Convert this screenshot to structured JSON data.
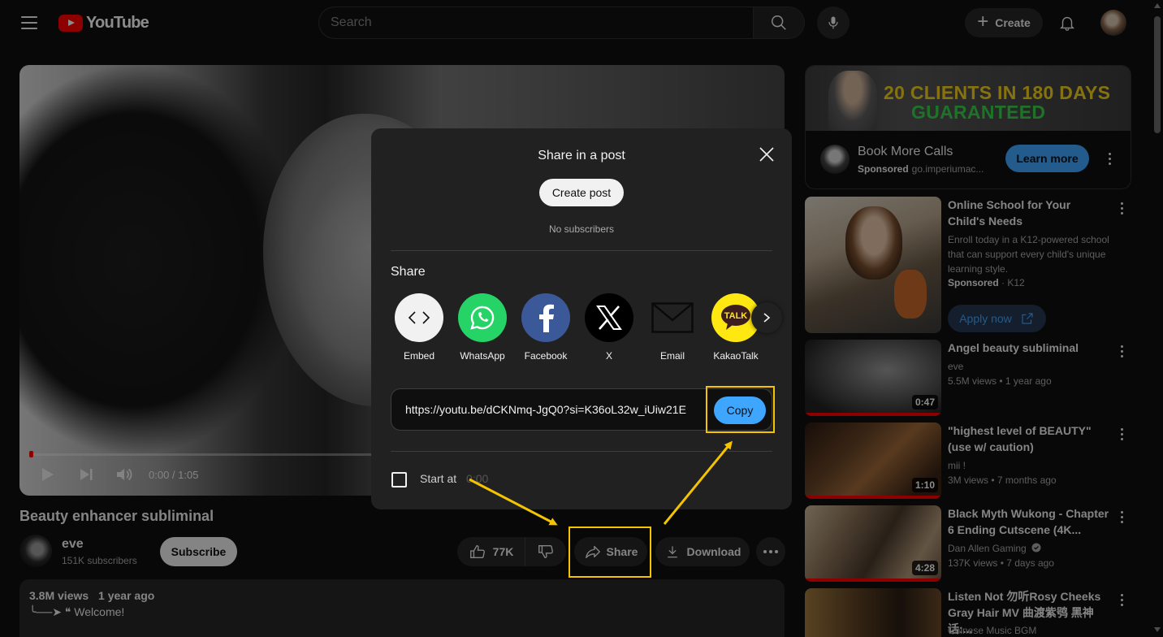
{
  "header": {
    "logo_text": "YouTube",
    "search_placeholder": "Search",
    "create_label": "Create"
  },
  "player": {
    "time": "0:00 / 1:05",
    "progress_fraction": 0.005
  },
  "video": {
    "title": "Beauty enhancer subliminal",
    "channel": "eve",
    "subscribers": "151K subscribers",
    "subscribe_label": "Subscribe",
    "likes": "77K",
    "share_label": "Share",
    "download_label": "Download",
    "views": "3.8M views",
    "age": "1 year ago",
    "description": "╰──➤ ❝ Welcome!"
  },
  "share_dialog": {
    "title": "Share in a post",
    "create_post_label": "Create post",
    "no_subscribers": "No subscribers",
    "share_heading": "Share",
    "targets": [
      {
        "label": "Embed",
        "icon": "embed-icon",
        "color": "#f1f1f1"
      },
      {
        "label": "WhatsApp",
        "icon": "whatsapp-icon",
        "color": "#25d366"
      },
      {
        "label": "Facebook",
        "icon": "facebook-icon",
        "color": "#3b5998"
      },
      {
        "label": "X",
        "icon": "x-icon",
        "color": "#000000"
      },
      {
        "label": "Email",
        "icon": "email-icon",
        "color": "#212121"
      },
      {
        "label": "KakaoTalk",
        "icon": "kakaotalk-icon",
        "color": "#ffe812"
      }
    ],
    "url": "https://youtu.be/dCKNmq-JgQ0?si=K36oL32w_iUiw21E",
    "copy_label": "Copy",
    "start_at_label": "Start at",
    "start_at_time": "0:00"
  },
  "sidebar": {
    "ad": {
      "headline_1": "20 CLIENTS IN 180 DAYS",
      "headline_2": "GUARANTEED",
      "title": "Book More Calls",
      "sponsored": "Sponsored",
      "domain": "go.imperiumac...",
      "cta": "Learn more"
    },
    "recommendations": [
      {
        "title": "Online School for Your Child's Needs",
        "description": "Enroll today in a K12-powered school that can support every child's unique learning style.",
        "sponsored": "Sponsored",
        "advertiser": "K12",
        "cta": "Apply now"
      },
      {
        "title": "Angel beauty subliminal",
        "channel": "eve",
        "views": "5.5M views",
        "age": "1 year ago",
        "duration": "0:47"
      },
      {
        "title": "\"highest level of BEAUTY\" (use w/ caution)",
        "channel": "mii !",
        "views": "3M views",
        "age": "7 months ago",
        "duration": "1:10"
      },
      {
        "title": "Black Myth Wukong - Chapter 6 Ending Cutscene (4K...",
        "channel": "Dan Allen Gaming",
        "views": "137K views",
        "age": "7 days ago",
        "duration": "4:28"
      },
      {
        "title": "Listen Not 勿听Rosy Cheeks Gray Hair MV 曲渡紫鸮 黑神话:...",
        "channel": "Chinese Music BGM"
      }
    ]
  },
  "colors": {
    "background": "#0f0f0f",
    "accent_blue": "#3ea6ff",
    "highlight": "#f5c400",
    "brand_red": "#ff0000"
  }
}
